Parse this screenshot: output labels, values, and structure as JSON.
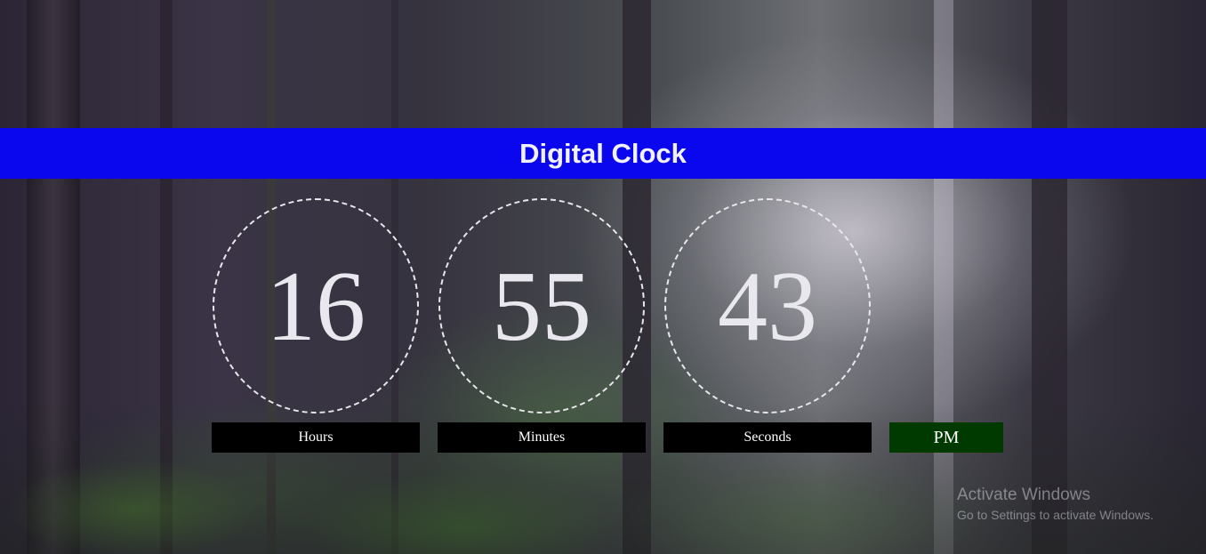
{
  "header": {
    "title": "Digital Clock"
  },
  "clock": {
    "hours": "16",
    "minutes": "55",
    "seconds": "43",
    "hours_label": "Hours",
    "minutes_label": "Minutes",
    "seconds_label": "Seconds",
    "ampm": "PM"
  },
  "watermark": {
    "title": "Activate Windows",
    "subtitle": "Go to Settings to activate Windows."
  },
  "colors": {
    "header_bg": "#0a06ee",
    "label_bg": "#000000",
    "ampm_bg": "#003a00"
  }
}
